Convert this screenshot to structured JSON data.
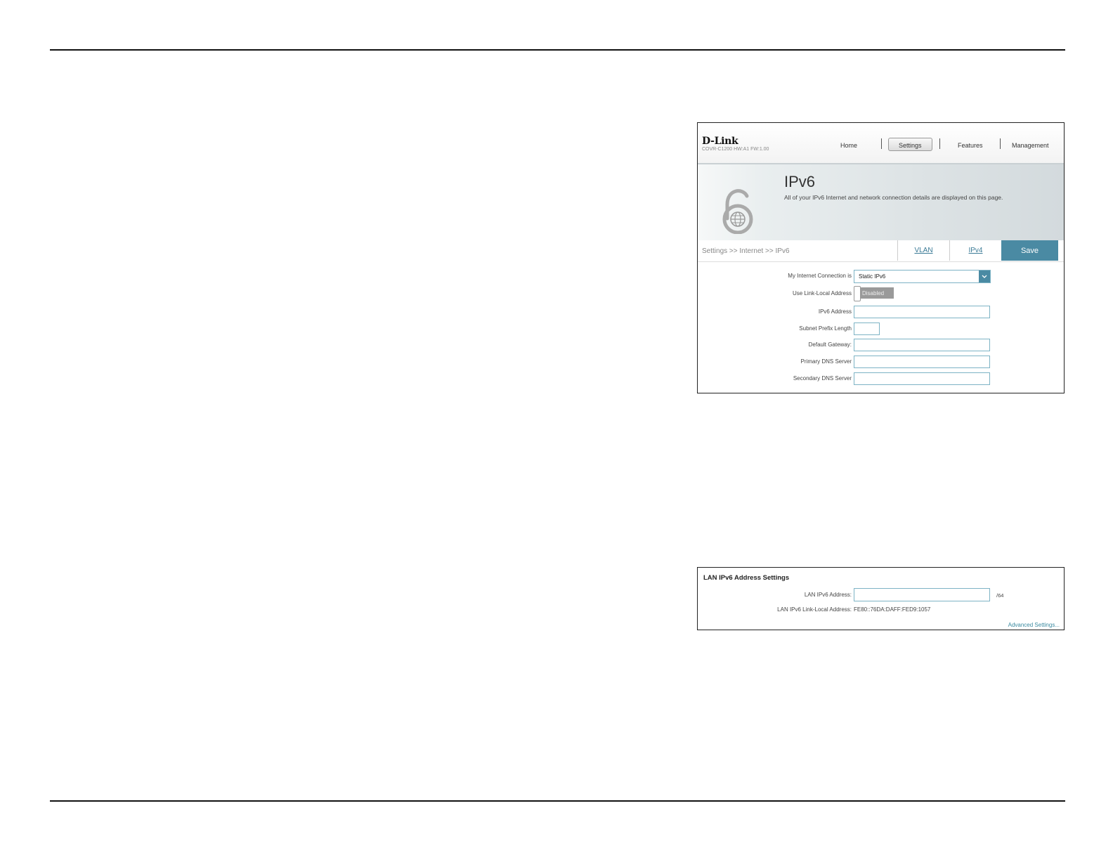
{
  "header": {
    "logo": "D-Link",
    "firmware": "COVR-C1200 HW:A1 FW:1.00",
    "nav": [
      "Home",
      "Settings",
      "Features",
      "Management"
    ],
    "active_nav": "Settings"
  },
  "hero": {
    "title": "IPv6",
    "description": "All of your IPv6 Internet and network connection details are displayed on this page."
  },
  "breadcrumb": "Settings >> Internet >> IPv6",
  "tabs": {
    "vlan": "VLAN",
    "ipv4": "IPv4",
    "save": "Save"
  },
  "form": {
    "connection_label": "My Internet Connection is",
    "connection_value": "Static IPv6",
    "link_local_label": "Use Link-Local Address",
    "link_local_toggle": "Disabled",
    "ipv6_address_label": "IPv6 Address",
    "subnet_prefix_label": "Subnet Prefix Length",
    "gateway_label": "Default Gateway:",
    "primary_dns_label": "Primary DNS Server",
    "secondary_dns_label": "Secondary DNS Server"
  },
  "lan": {
    "title": "LAN IPv6 Address Settings",
    "address_label": "LAN IPv6 Address:",
    "address_suffix": "/64",
    "link_local_label": "LAN IPv6 Link-Local Address:",
    "link_local_value": "FE80::76DA:DAFF:FED9:1057",
    "advanced": "Advanced Settings..."
  },
  "colors": {
    "accent": "#4a8aa3",
    "field_border": "#7db3c5",
    "link": "#3a8aa0"
  }
}
